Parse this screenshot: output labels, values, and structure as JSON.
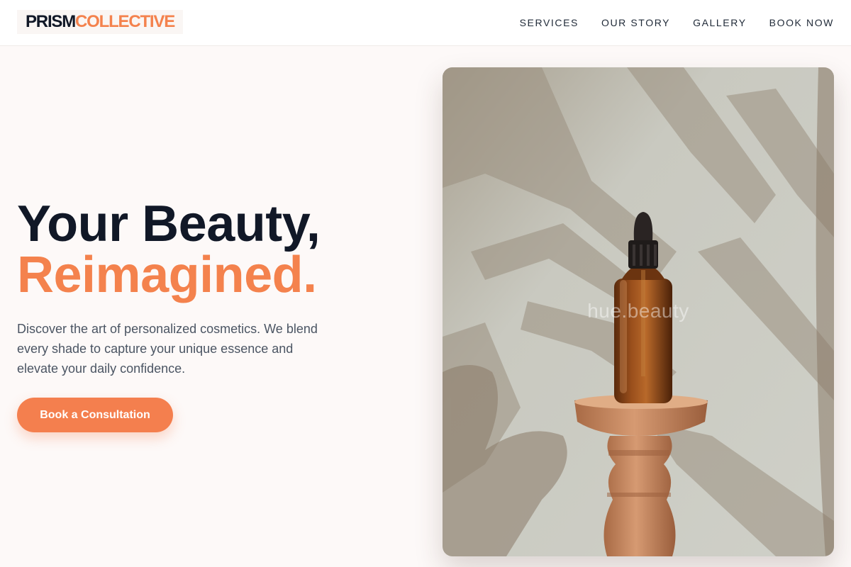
{
  "brand": {
    "part1": "PRISM",
    "part2": "COLLECTIVE"
  },
  "nav": {
    "items": [
      "SERVICES",
      "OUR STORY",
      "GALLERY",
      "BOOK NOW"
    ]
  },
  "hero": {
    "title_line1": "Your Beauty,",
    "title_line2": "Reimagined.",
    "description": "Discover the art of personalized cosmetics. We blend every shade to capture your unique essence and elevate your daily confidence.",
    "cta_label": "Book a Consultation"
  },
  "photo": {
    "watermark": "hue.beauty"
  },
  "colors": {
    "accent": "#f4824d",
    "heading": "#111827",
    "body_text": "#4b5563",
    "background": "#fdf9f8"
  }
}
